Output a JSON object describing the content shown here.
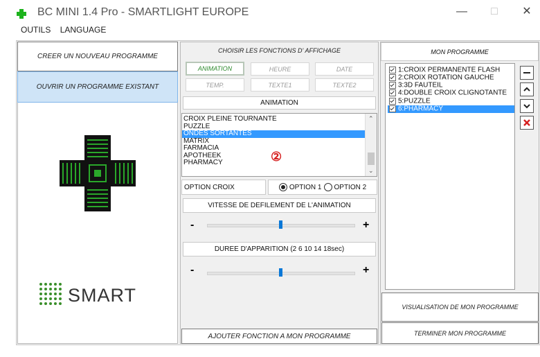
{
  "window": {
    "title": "BC MINI 1.4 Pro - SMARTLIGHT EUROPE",
    "minimize": "—",
    "maximize": "□",
    "close": "✕"
  },
  "menu": {
    "items": [
      "OUTILS",
      "LANGUAGE"
    ]
  },
  "left": {
    "create_label": "CREER UN NOUVEAU PROGRAMME",
    "open_label": "OUVRIR UN PROGRAMME EXISTANT",
    "logo_text": "SMART"
  },
  "middle": {
    "header": "CHOISIR LES FONCTIONS D' AFFICHAGE",
    "functions": [
      "ANIMATION",
      "HEURE",
      "DATE",
      "TEMP.",
      "TEXTE1",
      "TEXTE2"
    ],
    "section_title": "ANIMATION",
    "animations": [
      "CROIX PLEINE TOURNANTE",
      "PUZZLE",
      "ONDES SORTANTES",
      "MATRIX",
      "FARMACIA",
      "APOTHEEK",
      "PHARMACY"
    ],
    "selected_animation": "ONDES SORTANTES",
    "badge": "②",
    "option_label": "OPTION CROIX",
    "option1": "OPTION 1",
    "option2": "OPTION 2",
    "speed_label": "VITESSE DE DEFILEMENT DE L'ANIMATION",
    "duration_label": "DUREE D'APPARITION (2 6 10 14 18sec)",
    "minus": "-",
    "plus": "+",
    "speed_level": 0.5,
    "duration_level": 0.5,
    "add_label": "AJOUTER FONCTION A MON PROGRAMME"
  },
  "right": {
    "header": "MON PROGRAMME",
    "items": [
      "1:CROIX PERMANENTE FLASH",
      "2:CROIX ROTATION GAUCHE",
      "3:3D FAUTEIL",
      "4:DOUBLE CROIX CLIGNOTANTE",
      "5:PUZZLE",
      "6:PHARMACY"
    ],
    "visualise_label": "VISUALISATION DE MON PROGRAMME",
    "finish_label": "TERMINER MON PROGRAMME"
  },
  "colors": {
    "accent": "#3399ff",
    "selected_button": "#cfe4f7",
    "active_text": "#2e8b2e",
    "delete_red": "#d62020",
    "logo_green": "#3a8f2a"
  }
}
